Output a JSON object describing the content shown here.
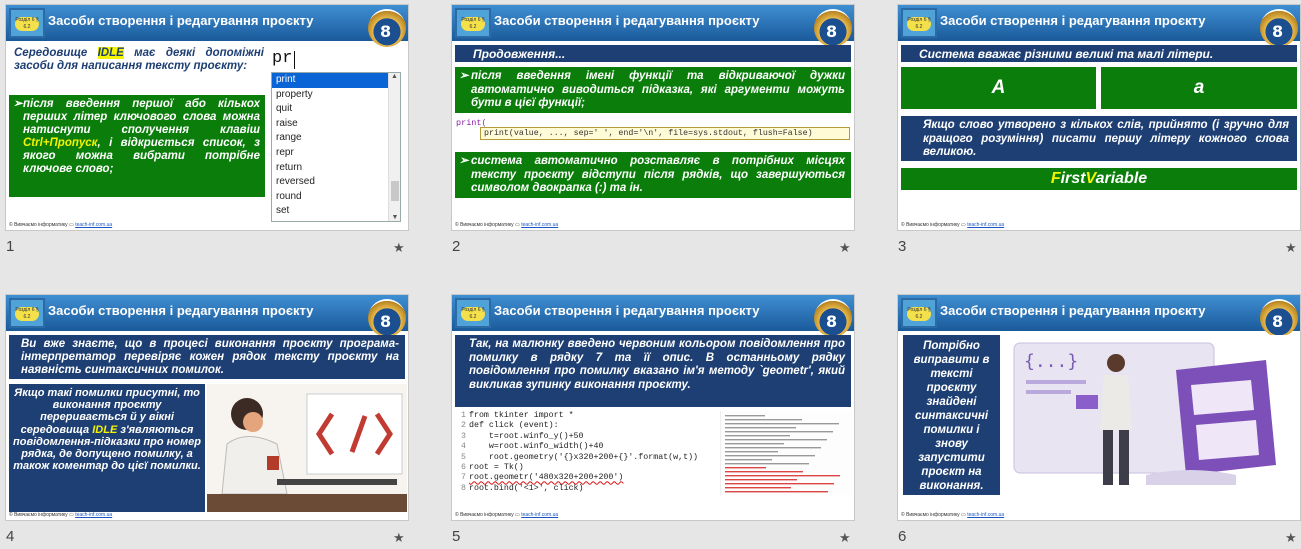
{
  "slide_title": "Засоби створення і редагування проєкту",
  "badge_text": "Розділ 6 § 6.2",
  "logo_text": "8",
  "footer_left": "© Вивчаємо інформатику",
  "footer_link": "teach-inf.com.ua",
  "star": "★",
  "slides": [
    {
      "number": "1",
      "intro": "Середовище IDLE має деякі допоміжні засоби для написання тексту проєкту:",
      "bullet": "після введення першої або кількох перших літер ключового слова можна натиснути сполучення клавіш Ctrl+Пропуск, і відкриється список, з якого можна вибрати потрібне ключове слово;",
      "typed": "pr",
      "list": [
        "print",
        "property",
        "quit",
        "raise",
        "range",
        "repr",
        "return",
        "reversed",
        "round",
        "set"
      ]
    },
    {
      "number": "2",
      "heading": "Продовження...",
      "bullet1": "після введення імені функції та відкриваючої дужки автоматично виводиться підказка, які аргументи можуть бути в цієї функції;",
      "code_call": "print(",
      "code_tip": "print(value, ..., sep=' ', end='\\n', file=sys.stdout, flush=False)",
      "bullet2": "система автоматично розставляє в потрібних місцях тексту проєкту відступи після рядків, що завершуються символом двокрапка (:) та ін."
    },
    {
      "number": "3",
      "heading": "Система вважає різними великі та малі літери.",
      "letter_a_upper": "A",
      "letter_a_lower": "a",
      "text": "Якщо слово утворено з кількох слів, прийнято (і зручно для кращого розуміння) писати першу літеру кожного слова великою.",
      "example_p1": "F",
      "example_p2": "irst",
      "example_p3": "V",
      "example_p4": "ariable"
    },
    {
      "number": "4",
      "top": "Ви вже знаєте, що в процесі виконання проєкту програма-інтерпретатор перевіряє кожен рядок тексту проєкту на наявність синтаксичних помилок.",
      "left": "Якщо такі помилки присутні, то виконання проєкту переривається й у вікні середовища IDLE з'являються повідомлення-підказки про номер рядка, де допущено помилку, а також коментар до цієї помилки."
    },
    {
      "number": "5",
      "top": "Так, на малюнку введено червоним кольором повідомлення про помилку в рядку 7 та її опис. В останньому рядку повідомлення про помилку вказано ім'я методу `geometr', який викликав зупинку виконання проєкту.",
      "code_lines": [
        "from tkinter import *",
        "def click (event):",
        "    t=root.winfo_y()+50",
        "    w=root.winfo_width()+40",
        "    root.geometry('{}x320+200+{}'.format(w,t))",
        "root = Tk()",
        "root.geometr('480x320+200+200')",
        "root.bind('<1>', click)"
      ],
      "line_numbers": [
        "1",
        "2",
        "3",
        "4",
        "5",
        "6",
        "7",
        "8"
      ]
    },
    {
      "number": "6",
      "text": "Потрібно виправити в тексті проєкту знайдені синтаксичні помилки і знову запустити проєкт на виконання."
    }
  ],
  "colors": {
    "navy": "#1e3f73",
    "green": "#0a7d0a",
    "highlight": "#f4f400",
    "header": "#2a74bb"
  }
}
